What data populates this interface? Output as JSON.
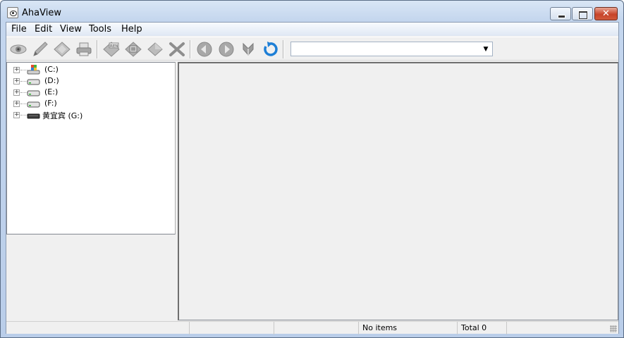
{
  "window": {
    "title": "AhaView"
  },
  "menu": {
    "file": "File",
    "edit": "Edit",
    "view": "View",
    "tools": "Tools",
    "help": "Help"
  },
  "toolbar": {
    "icons": [
      "eye-icon",
      "pencil-icon",
      "tag-icon",
      "printer-icon",
      "rename-icon",
      "slideshow-icon",
      "diamond-icon",
      "delete-icon",
      "back-icon",
      "forward-icon",
      "up-icon",
      "refresh-icon"
    ],
    "address_value": ""
  },
  "tree": {
    "items": [
      {
        "label": "(C:)",
        "icon": "windows-drive-icon"
      },
      {
        "label": "(D:)",
        "icon": "hard-drive-icon"
      },
      {
        "label": "(E:)",
        "icon": "hard-drive-icon"
      },
      {
        "label": "(F:)",
        "icon": "hard-drive-icon"
      },
      {
        "label": "黄宜宾 (G:)",
        "icon": "removable-drive-icon"
      }
    ],
    "expander_symbol": "+"
  },
  "statusbar": {
    "pane1": "",
    "pane2": "",
    "items_text": "No items",
    "total_text": "Total 0",
    "pane5": ""
  },
  "colors": {
    "close_button": "#c7442a",
    "title_gradient_top": "#d9e6f5",
    "refresh_blue": "#1e7fd6"
  }
}
